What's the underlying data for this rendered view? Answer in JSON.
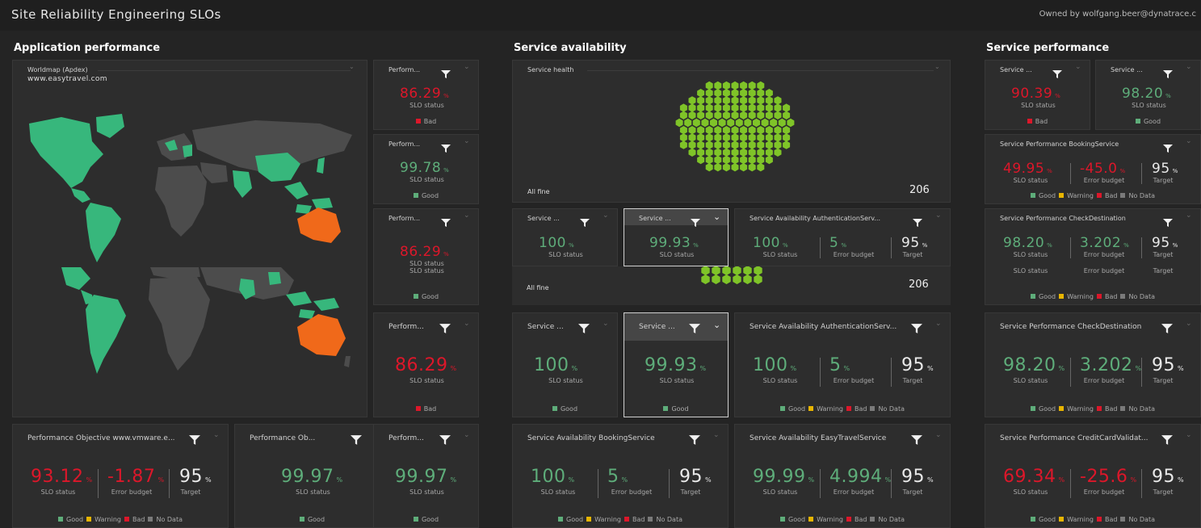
{
  "colors": {
    "good": "#5ead7a",
    "bad": "#dc172a",
    "warning": "#e8b500",
    "nodata": "#7a7a7a",
    "map_land": "#4c4c4c",
    "map_green": "#37b77c",
    "map_orange": "#f0691a",
    "hex": "#7fc428"
  },
  "header": {
    "title": "Site Reliability Engineering SLOs",
    "owner": "Owned by wolfgang.beer@dynatrace.c"
  },
  "sections": {
    "app": "Application performance",
    "svc_avail": "Service availability",
    "svc_perf": "Service performance"
  },
  "labels": {
    "pct": "%",
    "slo_status": "SLO status",
    "error_budget": "Error budget",
    "target": "Target",
    "good": "Good",
    "bad": "Bad",
    "warning": "Warning",
    "no_data": "No Data",
    "all_fine": "All fine"
  },
  "icons": {
    "filter": "filter-icon",
    "chevron": "chevron-down-icon"
  },
  "worldmap": {
    "title": "Worldmap (Apdex)",
    "subtitle": "www.easytravel.com"
  },
  "health": {
    "title": "Service health",
    "status": "All fine",
    "count": "206",
    "overlay_status": "All fine",
    "overlay_count": "206"
  },
  "tiles": {
    "ap1": {
      "title": "Perform...",
      "slo": "86.29",
      "status": "Bad"
    },
    "ap2": {
      "title": "Perform...",
      "slo": "99.78",
      "status": "Good"
    },
    "ap3": {
      "title": "Perform...",
      "slo": "86.29",
      "status": "Good"
    },
    "ap4": {
      "title": "Perform...",
      "slo": "86.29",
      "status": "Bad"
    },
    "ap5": {
      "title": "Performance Objective www.vmware.e...",
      "slo": "93.12",
      "budget": "-1.87",
      "target": "95"
    },
    "ap6": {
      "title": "Performance Ob...",
      "slo": "99.97",
      "status": "Good"
    },
    "ap7": {
      "title": "Perform...",
      "slo": "99.97",
      "status": "Good"
    },
    "sa1": {
      "title": "Service ...",
      "slo": "100"
    },
    "sa2": {
      "title": "Service ...",
      "slo": "99.93"
    },
    "sa3": {
      "title": "Service Availability AuthenticationServ...",
      "slo": "100",
      "budget": "5",
      "target": "95"
    },
    "sa4": {
      "title": "Service ...",
      "slo": "100",
      "status": "Good"
    },
    "sa5": {
      "title": "Service ...",
      "slo": "99.93",
      "status": "Good"
    },
    "sa6": {
      "title": "Service Availability AuthenticationServ...",
      "slo": "100",
      "budget": "5",
      "target": "95"
    },
    "sa7": {
      "title": "Service Availability BookingService",
      "slo": "100",
      "budget": "5",
      "target": "95"
    },
    "sa8": {
      "title": "Service Availability EasyTravelService",
      "slo": "99.99",
      "budget": "4.994",
      "target": "95"
    },
    "sp1": {
      "title": "Service ...",
      "slo": "90.39",
      "status": "Bad"
    },
    "sp2": {
      "title": "Service ...",
      "slo": "98.20",
      "status": "Good"
    },
    "sp3": {
      "title": "Service Performance BookingService",
      "slo": "49.95",
      "budget": "-45.0",
      "target": "95"
    },
    "sp4": {
      "title": "Service Performance CheckDestination",
      "slo": "98.20",
      "budget": "3.202",
      "target": "95"
    },
    "sp5": {
      "title": "Service Performance CheckDestination",
      "slo": "98.20",
      "budget": "3.202",
      "target": "95"
    },
    "sp6": {
      "title": "Service Performance CreditCardValidat...",
      "slo": "69.34",
      "budget": "-25.6",
      "target": "95"
    }
  }
}
